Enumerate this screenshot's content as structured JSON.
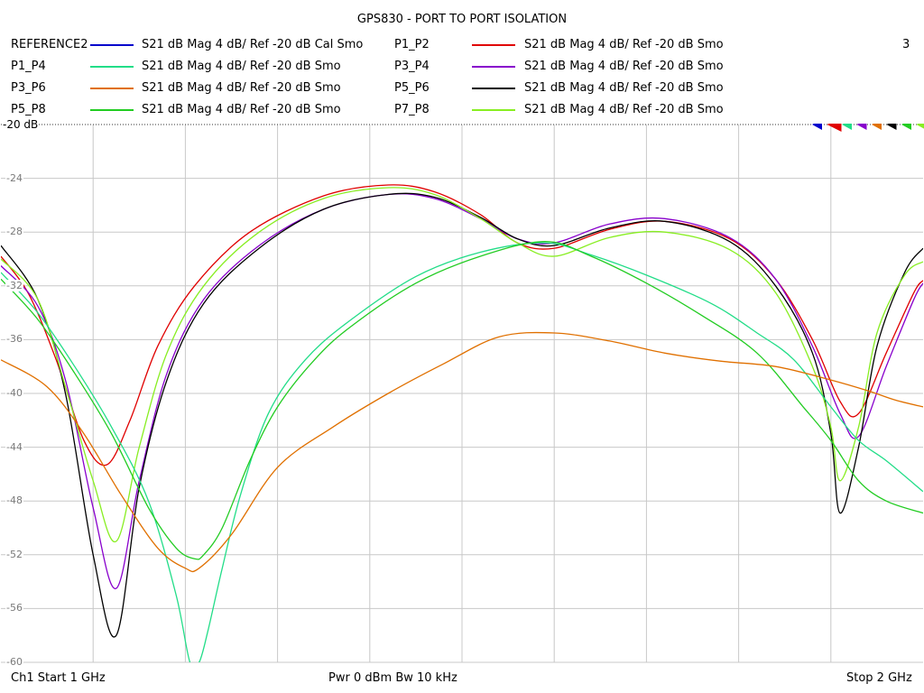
{
  "chart_data": {
    "type": "line",
    "title": "GPS830 - PORT TO PORT ISOLATION",
    "x_unit": "GHz",
    "xlim": [
      1.0,
      2.0
    ],
    "ylim": [
      -60,
      -20
    ],
    "ytick_labels": [
      "-24",
      "-28",
      "-32",
      "-36",
      "-40",
      "-44",
      "-48",
      "-52",
      "-56",
      "-60"
    ],
    "ytick_values": [
      -24,
      -28,
      -32,
      -36,
      -40,
      -44,
      -48,
      -52,
      -56,
      -60
    ],
    "reference_label": "-20 dB",
    "grid": true,
    "channel_number": "3",
    "legend": [
      {
        "name": "REFERENCE2",
        "desc": "S21  dB Mag  4 dB/ Ref -20 dB  Cal Smo",
        "color": "#0000cc"
      },
      {
        "name": "P1_P2",
        "desc": "S21  dB Mag  4 dB/ Ref -20 dB  Smo",
        "color": "#e00000"
      },
      {
        "name": "P1_P4",
        "desc": "S21  dB Mag  4 dB/ Ref -20 dB  Smo",
        "color": "#22dd88"
      },
      {
        "name": "P3_P4",
        "desc": "S21  dB Mag  4 dB/ Ref -20 dB  Smo",
        "color": "#8800cc"
      },
      {
        "name": "P3_P6",
        "desc": "S21  dB Mag  4 dB/ Ref -20 dB  Smo",
        "color": "#e07000"
      },
      {
        "name": "P5_P6",
        "desc": "S21  dB Mag  4 dB/ Ref -20 dB  Smo",
        "color": "#000000"
      },
      {
        "name": "P5_P8",
        "desc": "S21  dB Mag  4 dB/ Ref -20 dB  Smo",
        "color": "#22cc22"
      },
      {
        "name": "P7_P8",
        "desc": "S21  dB Mag  4 dB/ Ref -20 dB  Smo",
        "color": "#88ee22"
      }
    ],
    "marker_colors": [
      "#0000cc",
      "#e00000",
      "#22dd88",
      "#8800cc",
      "#e07000",
      "#000000",
      "#22cc22",
      "#88ee22"
    ],
    "series": [
      {
        "name": "P1_P2",
        "color": "#e00000",
        "x": [
          1.0,
          1.03,
          1.06,
          1.09,
          1.115,
          1.14,
          1.17,
          1.21,
          1.27,
          1.35,
          1.42,
          1.47,
          1.52,
          1.56,
          1.6,
          1.66,
          1.72,
          1.79,
          1.84,
          1.88,
          1.91,
          1.93,
          1.96,
          1.99,
          2.0
        ],
        "y": [
          -29.8,
          -32.6,
          -37.5,
          -43.5,
          -45.3,
          -42.0,
          -36.5,
          -32.0,
          -28.0,
          -25.3,
          -24.5,
          -25.0,
          -26.7,
          -28.8,
          -29.2,
          -27.8,
          -27.2,
          -28.5,
          -31.5,
          -36.0,
          -40.6,
          -41.5,
          -37.0,
          -32.5,
          -31.6
        ]
      },
      {
        "name": "P3_P4",
        "color": "#8800cc",
        "x": [
          1.0,
          1.04,
          1.07,
          1.1,
          1.125,
          1.15,
          1.18,
          1.22,
          1.28,
          1.35,
          1.42,
          1.47,
          1.52,
          1.56,
          1.6,
          1.66,
          1.72,
          1.79,
          1.84,
          1.88,
          1.91,
          1.93,
          1.96,
          1.99,
          2.0
        ],
        "y": [
          -30.5,
          -33.5,
          -39.0,
          -48.5,
          -54.5,
          -46.5,
          -38.5,
          -33.0,
          -29.0,
          -26.3,
          -25.2,
          -25.5,
          -27.0,
          -28.5,
          -28.8,
          -27.4,
          -27.0,
          -28.4,
          -31.5,
          -36.5,
          -41.5,
          -43.2,
          -38.0,
          -33.0,
          -31.8
        ]
      },
      {
        "name": "P5_P6",
        "color": "#000000",
        "x": [
          1.0,
          1.04,
          1.07,
          1.1,
          1.125,
          1.15,
          1.18,
          1.22,
          1.28,
          1.35,
          1.42,
          1.47,
          1.52,
          1.56,
          1.6,
          1.66,
          1.72,
          1.79,
          1.84,
          1.88,
          1.9,
          1.91,
          1.93,
          1.95,
          1.98,
          2.0
        ],
        "y": [
          -29.0,
          -33.0,
          -40.0,
          -52.0,
          -58.0,
          -47.0,
          -39.0,
          -33.3,
          -29.2,
          -26.3,
          -25.2,
          -25.4,
          -26.9,
          -28.5,
          -29.0,
          -27.7,
          -27.2,
          -28.7,
          -32.0,
          -37.0,
          -43.0,
          -48.9,
          -44.0,
          -36.5,
          -31.0,
          -29.2
        ]
      },
      {
        "name": "P7_P8",
        "color": "#88ee22",
        "x": [
          1.0,
          1.04,
          1.07,
          1.1,
          1.125,
          1.15,
          1.18,
          1.22,
          1.28,
          1.35,
          1.42,
          1.47,
          1.52,
          1.56,
          1.6,
          1.66,
          1.72,
          1.79,
          1.84,
          1.88,
          1.9,
          1.91,
          1.93,
          1.95,
          1.98,
          2.0
        ],
        "y": [
          -30.0,
          -33.0,
          -39.5,
          -46.5,
          -51.0,
          -44.0,
          -37.0,
          -32.0,
          -28.0,
          -25.5,
          -24.7,
          -25.2,
          -27.0,
          -28.8,
          -29.8,
          -28.4,
          -28.0,
          -29.3,
          -32.5,
          -38.0,
          -42.5,
          -46.5,
          -42.5,
          -35.5,
          -31.2,
          -30.2
        ]
      },
      {
        "name": "P1_P4",
        "color": "#22dd88",
        "x": [
          1.0,
          1.04,
          1.08,
          1.12,
          1.16,
          1.19,
          1.205,
          1.215,
          1.225,
          1.24,
          1.26,
          1.29,
          1.33,
          1.38,
          1.45,
          1.52,
          1.59,
          1.64,
          1.7,
          1.77,
          1.82,
          1.86,
          1.9,
          1.93,
          1.96,
          2.0
        ],
        "y": [
          -31.0,
          -34.0,
          -38.0,
          -42.5,
          -48.0,
          -55.0,
          -60.0,
          -60.0,
          -57.5,
          -53.0,
          -47.5,
          -41.5,
          -37.5,
          -34.5,
          -31.3,
          -29.5,
          -28.8,
          -29.7,
          -31.2,
          -33.3,
          -35.5,
          -37.5,
          -41.0,
          -43.5,
          -45.0,
          -47.3
        ]
      },
      {
        "name": "P5_P8",
        "color": "#22cc22",
        "x": [
          1.0,
          1.04,
          1.08,
          1.12,
          1.16,
          1.19,
          1.21,
          1.22,
          1.24,
          1.27,
          1.3,
          1.34,
          1.38,
          1.45,
          1.52,
          1.59,
          1.64,
          1.7,
          1.76,
          1.82,
          1.87,
          1.9,
          1.93,
          1.96,
          2.0
        ],
        "y": [
          -31.5,
          -34.5,
          -38.5,
          -43.0,
          -48.5,
          -51.5,
          -52.3,
          -52.0,
          -50.0,
          -45.0,
          -41.0,
          -37.5,
          -35.0,
          -31.8,
          -29.8,
          -28.7,
          -29.8,
          -31.8,
          -34.2,
          -37.0,
          -41.0,
          -43.5,
          -46.5,
          -48.0,
          -48.9
        ]
      },
      {
        "name": "P3_P6",
        "color": "#e07000",
        "x": [
          1.0,
          1.05,
          1.09,
          1.13,
          1.17,
          1.2,
          1.215,
          1.25,
          1.3,
          1.36,
          1.42,
          1.48,
          1.54,
          1.6,
          1.66,
          1.72,
          1.78,
          1.84,
          1.9,
          1.94,
          1.97,
          2.0
        ],
        "y": [
          -37.5,
          -39.5,
          -43.0,
          -47.5,
          -51.5,
          -53.0,
          -53.0,
          -50.5,
          -45.5,
          -42.5,
          -40.0,
          -37.8,
          -35.8,
          -35.5,
          -36.1,
          -37.0,
          -37.6,
          -38.0,
          -39.0,
          -39.8,
          -40.5,
          -41.0
        ]
      }
    ]
  },
  "footer": {
    "left": "Ch1  Start  1 GHz",
    "center": "Pwr  0 dBm  Bw  10 kHz",
    "right": "Stop  2 GHz"
  }
}
